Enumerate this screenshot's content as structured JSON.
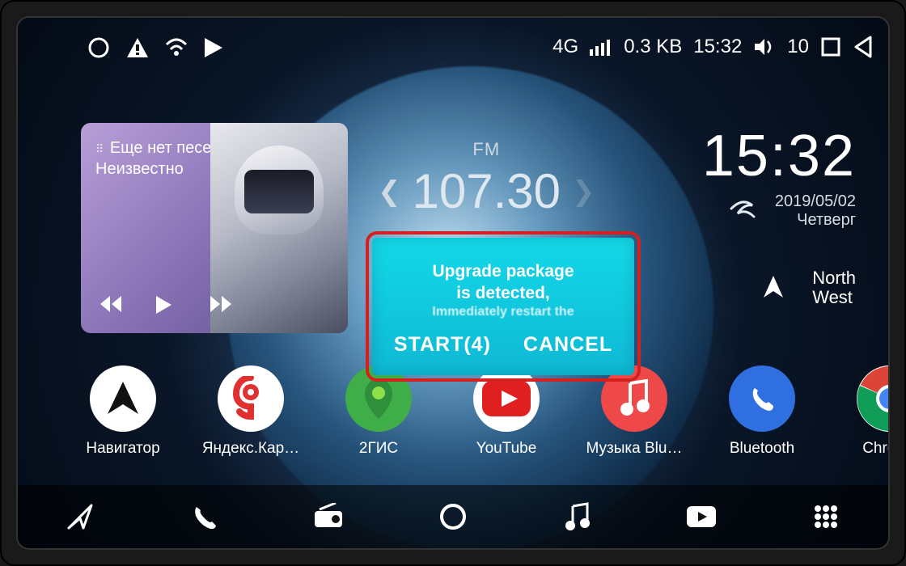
{
  "statusbar": {
    "network": "4G",
    "data_rate": "0.3 KB",
    "clock": "15:32",
    "volume_level": "10"
  },
  "music_widget": {
    "line1": "Еще нет песен",
    "line2": "Неизвестно"
  },
  "radio": {
    "band": "FM",
    "frequency": "107.30"
  },
  "clock": {
    "time": "15:32",
    "date": "2019/05/02",
    "weekday": "Четверг"
  },
  "compass": {
    "direction_line1": "North",
    "direction_line2": "West"
  },
  "apps": [
    {
      "label": "Навигатор",
      "bg": "#ffffff",
      "fg": "#222",
      "glyph": "➤",
      "accent": "#ffcc00"
    },
    {
      "label": "Яндекс.Кар…",
      "bg": "#ffffff",
      "fg": "#e03030",
      "glyph": "9"
    },
    {
      "label": "2ГИС",
      "bg": "#3fae49",
      "fg": "#fff",
      "glyph": "◆"
    },
    {
      "label": "YouTube",
      "bg": "#ffffff",
      "fg": "#e02020",
      "glyph": "▶"
    },
    {
      "label": "Музыка Blu…",
      "bg": "#ef4848",
      "fg": "#fff",
      "glyph": "♪"
    },
    {
      "label": "Bluetooth",
      "bg": "#2f6fe0",
      "fg": "#fff",
      "glyph": "phone"
    },
    {
      "label": "Chrome",
      "bg": "#ffffff",
      "fg": "#555",
      "glyph": "chrome"
    }
  ],
  "dialog": {
    "line1": "Upgrade package",
    "line2": "is detected,",
    "line3": "Immediately restart the",
    "start_label": "START(4)",
    "cancel_label": "CANCEL"
  }
}
